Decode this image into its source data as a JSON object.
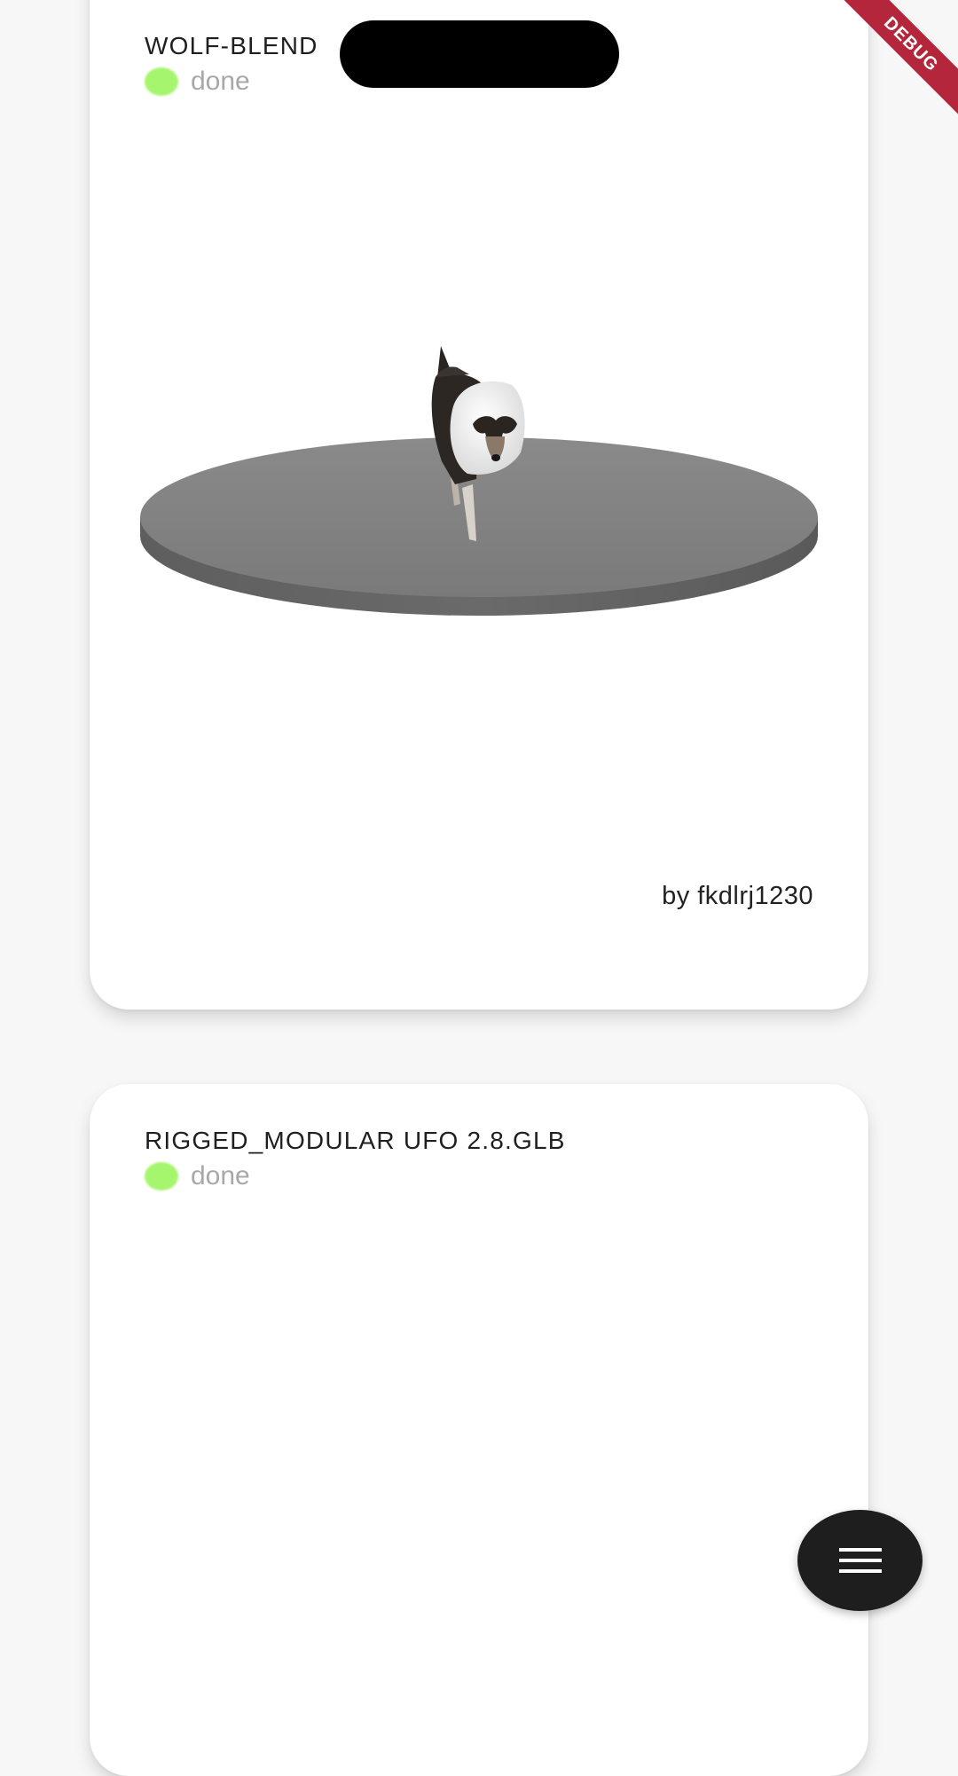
{
  "cards": [
    {
      "title": "WOLF-BLEND",
      "status": "done",
      "author": "by fkdlrj1230"
    },
    {
      "title": "RIGGED_MODULAR UFO 2.8.GLB",
      "status": "done"
    }
  ],
  "debug_banner": "DEBUG",
  "fab": {
    "icon": "menu-icon"
  },
  "colors": {
    "status_done": "#a6f56e",
    "debug_banner": "#b3263b",
    "fab_background": "#1e1e1e"
  }
}
